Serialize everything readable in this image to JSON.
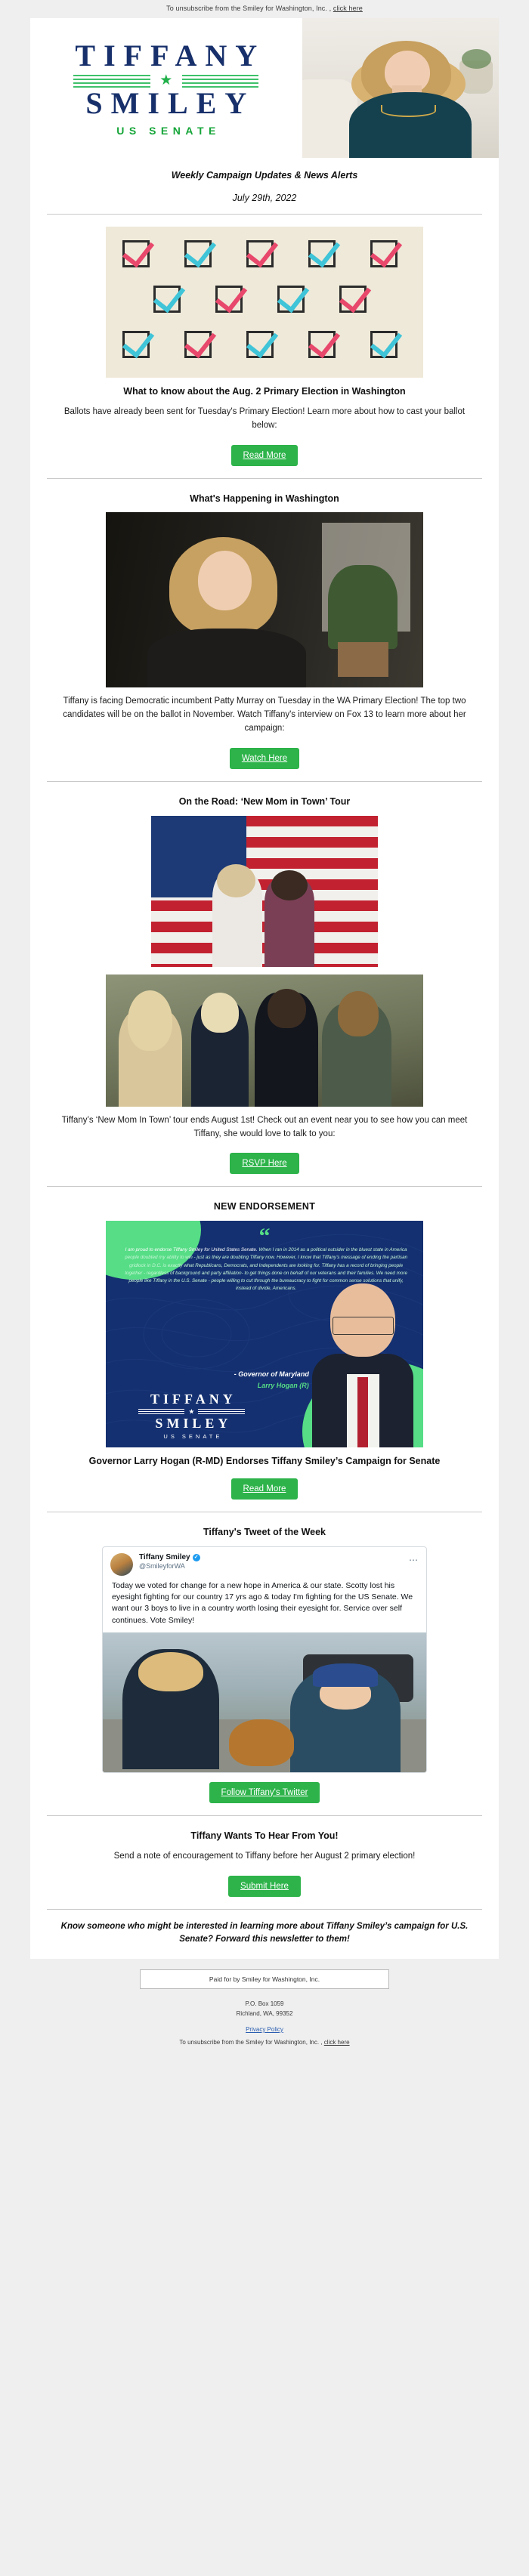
{
  "preheader": {
    "text": "To unsubscribe from the Smiley for Washington, Inc. ,",
    "link": "click here"
  },
  "header": {
    "logo_line1": "TIFFANY",
    "logo_line2": "SMILEY",
    "logo_subtitle": "US SENATE",
    "star_glyph": "★",
    "portrait_alt": "Tiffany Smiley portrait"
  },
  "masthead": {
    "tagline": "Weekly Campaign Updates & News Alerts",
    "date": "July 29th, 2022"
  },
  "sections": [
    {
      "id": "primary-election",
      "image_name": "ballot-checkboxes-image",
      "title": "What to know about the Aug. 2 Primary Election in Washington",
      "body": "Ballots have already been sent for Tuesday's Primary Election! Learn more about how to cast your ballot below:",
      "button": "Read More"
    },
    {
      "id": "whats-happening",
      "title": "What's Happening in Washington",
      "image_name": "fox13-interview-image",
      "body": "Tiffany is facing Democratic incumbent Patty Murray on Tuesday in the WA Primary Election! The top two candidates will be on the ballot in November. Watch Tiffany's interview on Fox 13 to learn more about her campaign:",
      "button": "Watch Here"
    },
    {
      "id": "on-the-road",
      "title": "On the Road: ‘New Mom in Town’ Tour",
      "image_name_1": "flag-event-photo",
      "image_name_2": "supporters-outdoor-photo",
      "body": "Tiffany’s ‘New Mom In Town’ tour ends August 1st! Check out an event near you to see how you can meet Tiffany, she would love to talk to you:",
      "button": "RSVP Here"
    },
    {
      "id": "endorsement",
      "title": "NEW ENDORSEMENT",
      "caption": "Governor Larry Hogan (R-MD) Endorses Tiffany Smiley’s Campaign for Senate",
      "button": "Read More"
    },
    {
      "id": "tweet",
      "title": "Tiffany's Tweet of the Week",
      "button": "Follow Tiffany's Twitter"
    },
    {
      "id": "hear-from-you",
      "title": "Tiffany Wants To Hear From You!",
      "body": "Send a note of encouragement to Tiffany before her August 2 primary election!",
      "button": "Submit Here"
    }
  ],
  "endorsement_card": {
    "quote_mark": "“",
    "quote_lead": "I am proud to endorse Tiffany Smiley for United States Senate.",
    "quote_body": "When I ran in 2014 as a political outsider in the bluest state in America people doubted my ability to win - just as they are doubting Tiffany now. However, I know that Tiffany’s message of ending the partisan gridlock in D.C. is exactly what Republicans, Democrats, and Independents are looking for. Tiffany has a record of bringing people together - regardless of background and party affiliation- to get things done on behalf of our veterans and their families. We need more people like Tiffany in the U.S. Senate - people willing to cut through the bureaucracy to fight for common sense solutions that unify, instead of divide, Americans.",
    "attrib_title": "- Governor of Maryland",
    "attrib_name": "Larry Hogan (R)",
    "logo_line1": "TIFFANY",
    "logo_line2": "SMILEY",
    "logo_sub": "US SENATE",
    "star_glyph": "★"
  },
  "tweet_card": {
    "display_name": "Tiffany Smiley",
    "verified_glyph": "✓",
    "handle": "@SmileyforWA",
    "more_glyph": "⋯",
    "text": "Today we voted for change for a new hope in America & our state. Scotty lost his eyesight fighting for our country 17 yrs ago & today I'm fighting for the US Senate. We want our 3 boys to live in a country worth losing their eyesight for. Service over self continues. Vote Smiley!"
  },
  "forward_banner": "Know someone who might be interested in learning more about Tiffany Smiley’s campaign for U.S. Senate? Forward this newsletter to them!",
  "footer": {
    "paid_for": "Paid for by Smiley for Washington, Inc.",
    "address_line1": "P.O. Box 1059",
    "address_line2": "Richland, WA, 99352",
    "privacy_label": "Privacy Policy",
    "unsubscribe_text": "To unsubscribe from the Smiley for Washington, Inc. ,",
    "unsubscribe_link": "click here"
  },
  "colors": {
    "brand_navy": "#17306b",
    "brand_green": "#15a538",
    "button_green": "#2db34a",
    "page_bg": "#efefef"
  }
}
